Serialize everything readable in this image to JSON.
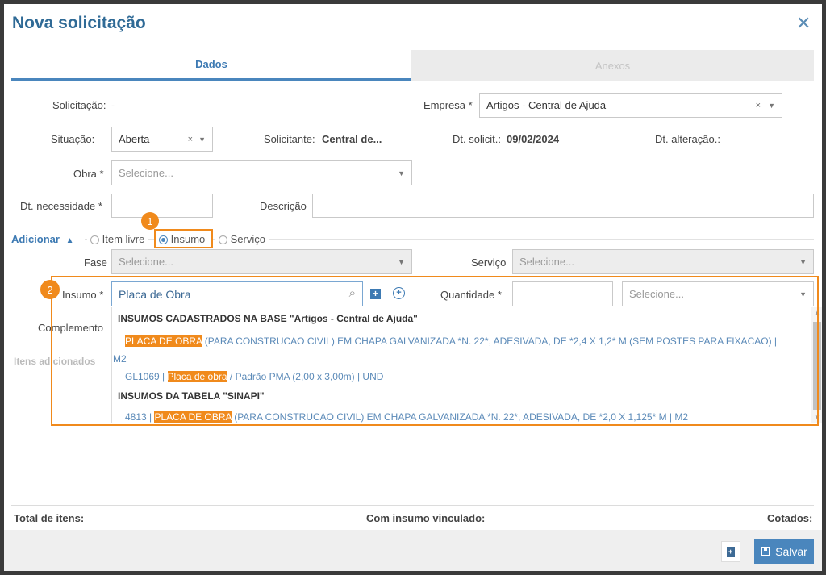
{
  "modal": {
    "title": "Nova solicitação"
  },
  "tabs": [
    {
      "label": "Dados"
    },
    {
      "label": "Anexos"
    }
  ],
  "form": {
    "solicitacao_label": "Solicitação:",
    "solicitacao_value": "-",
    "empresa_label": "Empresa *",
    "empresa_value": "Artigos - Central de Ajuda",
    "situacao_label": "Situação:",
    "situacao_value": "Aberta",
    "solicitante_label": "Solicitante:",
    "solicitante_value": "Central de...",
    "dt_solicit_label": "Dt. solicit.:",
    "dt_solicit_value": "09/02/2024",
    "dt_alteracao_label": "Dt. alteração.:",
    "obra_label": "Obra *",
    "obra_placeholder": "Selecione...",
    "dt_necessidade_label": "Dt. necessidade *",
    "descricao_label": "Descrição"
  },
  "adicionar": {
    "label": "Adicionar",
    "options": [
      {
        "label": "Item livre",
        "selected": false
      },
      {
        "label": "Insumo",
        "selected": true
      },
      {
        "label": "Serviço",
        "selected": false
      }
    ],
    "fase_label": "Fase",
    "fase_placeholder": "Selecione...",
    "servico_label": "Serviço",
    "servico_placeholder": "Selecione...",
    "insumo_label": "Insumo *",
    "insumo_value": "Placa de Obra",
    "quantidade_label": "Quantidade *",
    "unidade_placeholder": "Selecione...",
    "complemento_label": "Complemento",
    "itens_adicionados_label": "Itens adicionados"
  },
  "dropdown": {
    "group1": "INSUMOS CADASTRADOS NA BASE \"Artigos - Central de Ajuda\"",
    "item1_highlight": "PLACA DE OBRA",
    "item1_rest": " (PARA CONSTRUCAO CIVIL) EM CHAPA GALVANIZADA *N. 22*, ADESIVADA, DE *2,4 X 1,2* M (SEM POSTES PARA FIXACAO) |",
    "item1_unit": "M2",
    "item2_code": "GL1069 | ",
    "item2_highlight": "Placa de obra",
    "item2_rest": " / Padrão PMA (2,00 x 3,00m) | UND",
    "group2": "INSUMOS DA TABELA \"SINAPI\"",
    "item3_code": "4813 | ",
    "item3_highlight": "PLACA DE OBRA",
    "item3_rest": " (PARA CONSTRUCAO CIVIL) EM CHAPA GALVANIZADA *N. 22*, ADESIVADA, DE *2,0 X 1,125* M | M2"
  },
  "callouts": [
    "1",
    "2"
  ],
  "totals": {
    "total_itens": "Total de itens:",
    "com_insumo": "Com insumo vinculado:",
    "cotados": "Cotados:"
  },
  "buttons": {
    "salvar": "Salvar"
  },
  "colors": {
    "accent": "#2f6a96",
    "highlight": "#f08a1c",
    "save_button": "#4a86bd"
  }
}
